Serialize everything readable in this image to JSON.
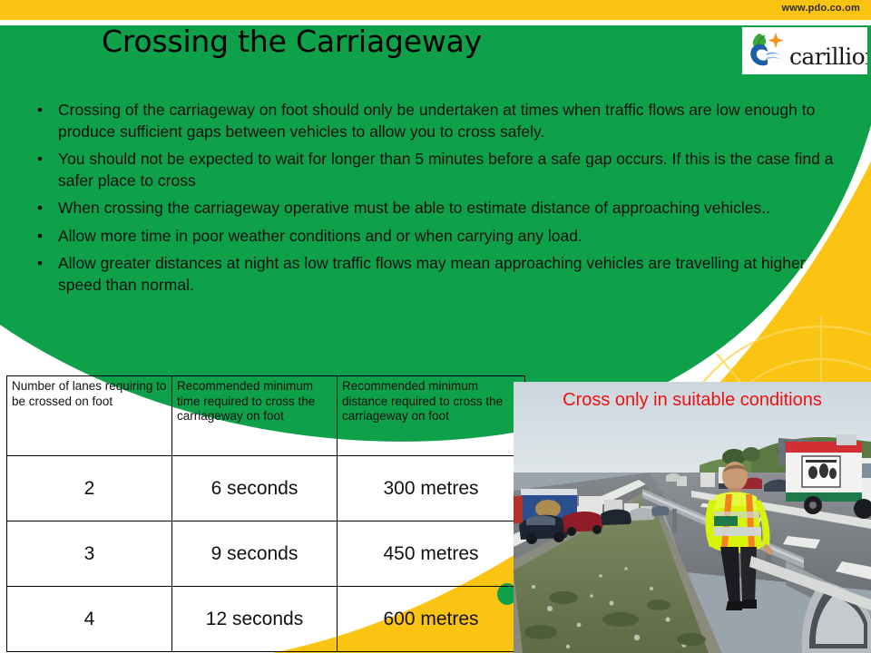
{
  "header": {
    "url_label": "www.pdo.co.om",
    "logo_word": "carillion",
    "logo_icon": "carillion-leaf-star-swoosh"
  },
  "title": "Crossing the Carriageway",
  "bullets": [
    "Crossing of the carriageway on foot should only be undertaken at times when traffic flows are low enough to produce sufficient gaps between vehicles to allow you to cross safely.",
    "You should not be expected to wait for longer than 5 minutes before a safe gap occurs. If this is the case find a safer place to cross",
    "When crossing the carriageway operative must be able to estimate distance of approaching vehicles..",
    "Allow more time in poor weather conditions  and or  when carrying any load.",
    "Allow greater distances at night as low traffic flows may mean approaching vehicles are travelling at higher speed than normal."
  ],
  "bullet_marker": "•",
  "table": {
    "headers": [
      "Number of lanes requiring to be crossed on foot",
      "Recommended minimum time required to cross the carriageway on foot",
      "Recommended minimum distance required to cross the carriageway on foot"
    ],
    "rows": [
      [
        "2",
        "6 seconds",
        "300 metres"
      ],
      [
        "3",
        "9 seconds",
        "450 metres"
      ],
      [
        "4",
        "12 seconds",
        "600 metres"
      ]
    ]
  },
  "photo": {
    "caption": "Cross only in suitable conditions",
    "alt": "Motorway with queued traffic on left carriageway, central reservation barrier, and a worker in a hi-vis yellow vest standing by the barrier"
  },
  "colors": {
    "yellow_bar": "#fbc412",
    "green": "#0fa04a",
    "caption_red": "#ee1111",
    "white": "#ffffff",
    "text_black": "#111111"
  }
}
